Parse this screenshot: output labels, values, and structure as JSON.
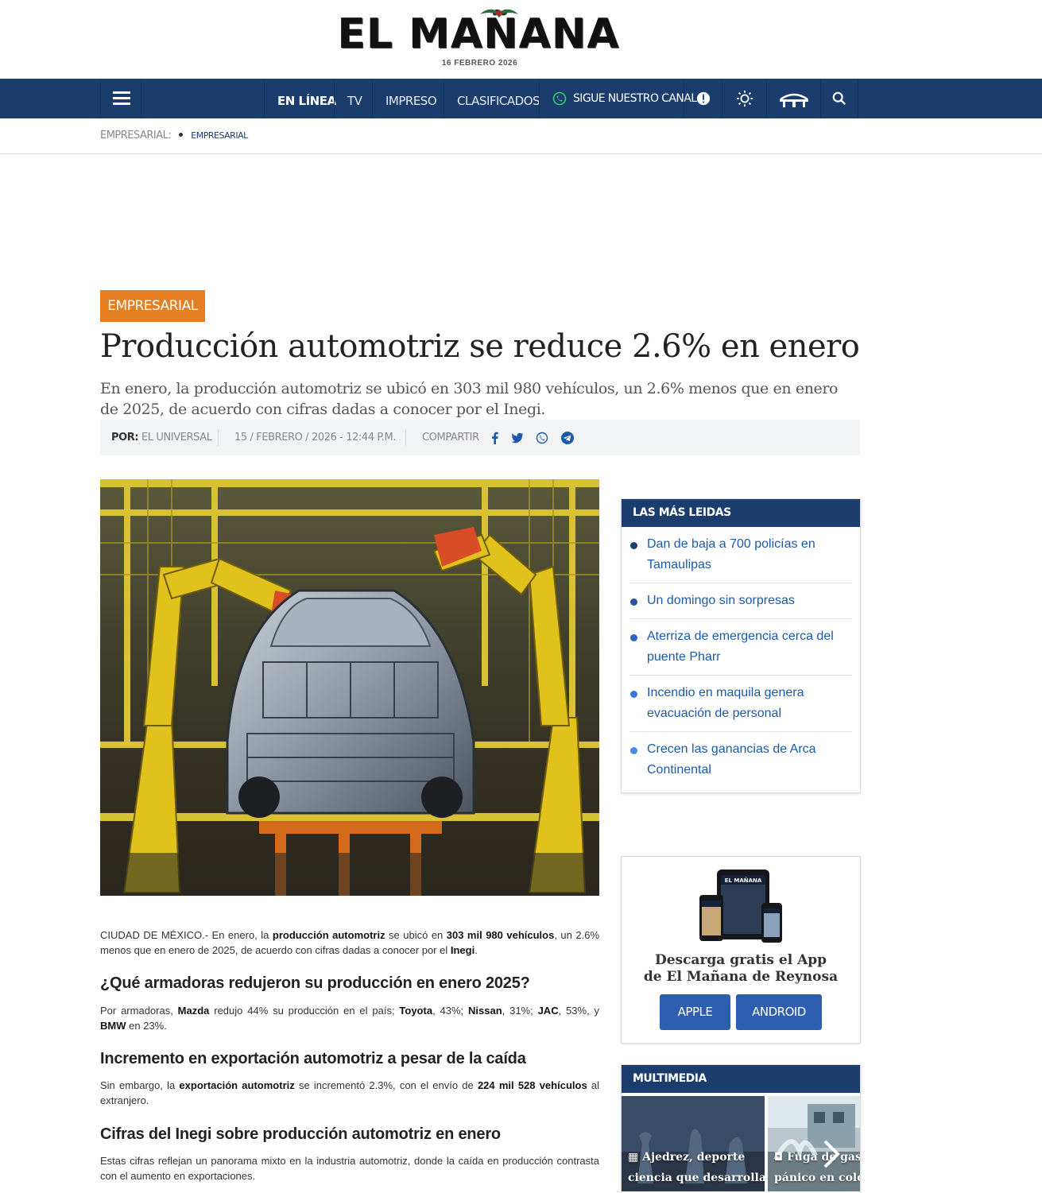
{
  "brand": {
    "logo_text": "EL MAÑANA",
    "date": "16 FEBRERO 2026",
    "nav_color": "#1b3d6e",
    "accent": "#e67e22"
  },
  "nav": {
    "items": [
      "EN LÍNEA",
      "TV",
      "IMPRESO",
      "CLASIFICADOS"
    ],
    "channel_label": "SIGUE NUESTRO CANAL",
    "icons": [
      "menu-icon",
      "whatsapp-icon",
      "alert-icon",
      "sun-icon",
      "bridge-icon",
      "search-icon"
    ]
  },
  "breadcrumb": {
    "section": "EMPRESARIAL:",
    "current": "EMPRESARIAL"
  },
  "article": {
    "tag": "EMPRESARIAL",
    "title": "Producción automotriz se reduce 2.6% en enero",
    "subtitle": "En enero, la producción automotriz se ubicó en 303 mil 980 vehículos, un 2.6% menos que en enero de 2025, de acuerdo con cifras dadas a conocer por el Inegi.",
    "byline_label": "POR:",
    "byline": "EL UNIVERSAL",
    "datetime": "15 / FEBRERO / 2026 - 12:44 P.M.",
    "share_label": "COMPARTIR",
    "p1": {
      "a": "CIUDAD DE MÉXICO.- En enero, la ",
      "b": "producción automotriz",
      "c": " se ubicó en ",
      "d": "303 mil 980 vehículos",
      "e": ", un 2.6% menos que en enero de 2025, de acuerdo con cifras dadas a conocer por el ",
      "f": "Inegi",
      "g": "."
    },
    "h1": "¿Qué armadoras redujeron su producción en enero 2025?",
    "p2": {
      "a": "Por armadoras, ",
      "b": "Mazda",
      "c": " redujo 44% su producción en el país; ",
      "d": "Toyota",
      "e": ", 43%; ",
      "f": "Nissan",
      "g": ", 31%; ",
      "h": "JAC",
      "i": ", 53%, y ",
      "j": "BMW",
      "k": " en 23%."
    },
    "h2": "Incremento en exportación automotriz a pesar de la caída",
    "p3": {
      "a": "Sin embargo, la ",
      "b": "exportación automotriz",
      "c": " se incrementó 2.3%, con el envío de ",
      "d": "224 mil 528 vehículos",
      "e": " al extranjero."
    },
    "h3": "Cifras del Inegi sobre producción automotriz en enero",
    "p4": "Estas cifras reflejan un panorama mixto en la industria automotriz, donde la caída en producción contrasta con el aumento en exportaciones."
  },
  "sidebar": {
    "most_read_title": "LAS MÁS LEIDAS",
    "most_read": [
      {
        "label": "Dan de baja a 700 policías en Tamaulipas",
        "color": "#1b3d6e"
      },
      {
        "label": "Un domingo sin sorpresas",
        "color": "#2752a0"
      },
      {
        "label": "Aterriza de emergencia cerca del puente Pharr",
        "color": "#2f65c0"
      },
      {
        "label": "Incendio en maquila genera evacuación de personal",
        "color": "#3b77d6"
      },
      {
        "label": "Crecen las ganancias de Arca Continental",
        "color": "#4a88e6"
      }
    ],
    "app": {
      "title_l1": "Descarga gratis el App",
      "title_l2": "de El Mañana de Reynosa",
      "apple": "APPLE",
      "android": "ANDROID",
      "screen_logo": "EL MAÑANA"
    },
    "multimedia_title": "MULTIMEDIA",
    "multimedia": [
      {
        "l1": "Ajedrez, deporte",
        "l2": "ciencia que desarrolla a"
      },
      {
        "l1": "Fuga de gas g",
        "l2": "pánico en coloni"
      }
    ]
  }
}
